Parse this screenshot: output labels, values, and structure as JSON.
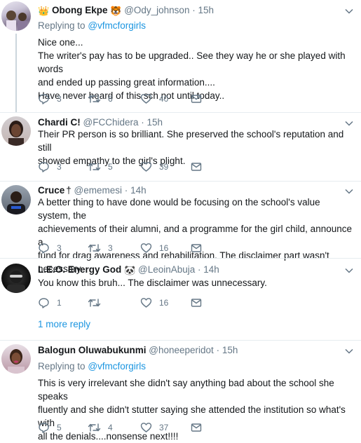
{
  "tweets": [
    {
      "name": "Obong Ekpe",
      "name_prefix_emoji": "👑",
      "name_suffix_emoji": "🐯",
      "handle": "@Ody_johnson",
      "time": "15h",
      "replying_label": "Replying to",
      "replying_to": "@vfmcforgirls",
      "lines": [
        "Nice one...",
        "The writer's pay has to be upgraded.. See they way he or she played with words",
        "and ended up passing great information....",
        "Have never heard of this sch not until today.."
      ],
      "reply_count": "3",
      "retweet_count": "6",
      "like_count": "40"
    },
    {
      "name": "Chardi C!",
      "handle": "@FCChidera",
      "time": "15h",
      "lines": [
        "Their PR person is so brilliant. She preserved the school's reputation and still",
        "showed empathy to the girl's plight."
      ],
      "reply_count": "3",
      "retweet_count": "5",
      "like_count": "39"
    },
    {
      "name": "Cruce",
      "name_suffix": "†",
      "handle": "@ememesi",
      "time": "14h",
      "lines": [
        "A better thing to have done would be focusing on the school's value system, the",
        "achievements of their alumni, and a programme for the girl child, announce a",
        "fund for drag awareness and rehabilitation. The disclaimer part wasn't necessary"
      ],
      "reply_count": "3",
      "retweet_count": "3",
      "like_count": "16"
    },
    {
      "name": "L.E.O. Energy God",
      "name_suffix_emoji": "🐼",
      "handle": "@LeoinAbuja",
      "time": "14h",
      "lines": [
        "You know this bruh... The disclaimer was unnecessary."
      ],
      "reply_count": "1",
      "retweet_count": "",
      "like_count": "16"
    },
    {
      "name": "Balogun Oluwabukunmi",
      "handle": "@honeeperidot",
      "time": "15h",
      "replying_label": "Replying to",
      "replying_to": "@vfmcforgirls",
      "lines": [
        "This is very irrelevant she didn't say anything bad about the school she speaks",
        "fluently and she didn't stutter saying she attended the institution so what's with",
        "all the denials....nonsense next!!!!"
      ],
      "reply_count": "5",
      "retweet_count": "4",
      "like_count": "37"
    }
  ],
  "more_replies_label": "1 more reply",
  "colors": {
    "link": "#1b95e0",
    "muted": "#657786",
    "divider": "#e6ecf0"
  }
}
